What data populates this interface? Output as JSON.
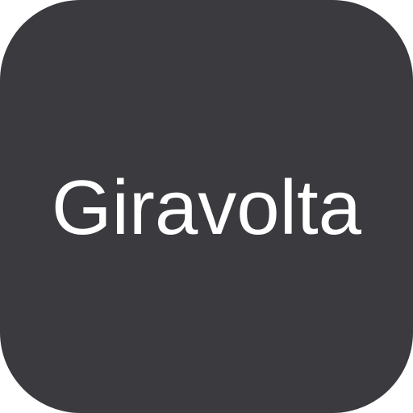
{
  "app_icon": {
    "wordmark": "Giravolta",
    "background_color": "#3a3a3f",
    "text_color": "#ffffff"
  }
}
